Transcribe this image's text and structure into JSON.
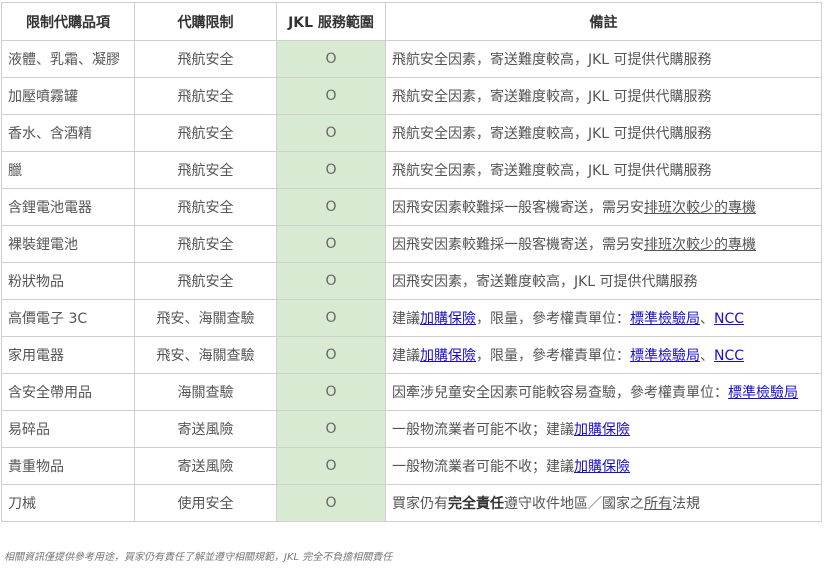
{
  "table": {
    "headers": [
      "限制代購品項",
      "代購限制",
      "JKL 服務範圍",
      "備註"
    ],
    "rows": [
      {
        "item": "液體、乳霜、凝膠",
        "limit": "飛航安全",
        "scope": "O",
        "note": "飛航安全因素，寄送難度較高，JKL 可提供代購服務"
      },
      {
        "item": "加壓噴霧罐",
        "limit": "飛航安全",
        "scope": "O",
        "note": "飛航安全因素，寄送難度較高，JKL 可提供代購服務"
      },
      {
        "item": "香水、含酒精",
        "limit": "飛航安全",
        "scope": "O",
        "note": "飛航安全因素，寄送難度較高，JKL 可提供代購服務"
      },
      {
        "item": "臘",
        "limit": "飛航安全",
        "scope": "O",
        "note": "飛航安全因素，寄送難度較高，JKL 可提供代購服務"
      },
      {
        "item": "含鋰電池電器",
        "limit": "飛航安全",
        "scope": "O",
        "note_a": "因飛安因素較難採一般客機寄送，需另安",
        "note_u": "排班次較少的專機"
      },
      {
        "item": "裸裝鋰電池",
        "limit": "飛航安全",
        "scope": "O",
        "note_a": "因飛安因素較難採一般客機寄送，需另安",
        "note_u": "排班次較少的專機"
      },
      {
        "item": "粉狀物品",
        "limit": "飛航安全",
        "scope": "O",
        "note": "因飛安因素，寄送難度較高，JKL 可提供代購服務"
      },
      {
        "item": "高價電子 3C",
        "limit": "飛安、海關查驗",
        "scope": "O",
        "note_a": "建議",
        "link1": "加購保險",
        "note_b": "，限量，參考權責單位：",
        "link2": "標準檢驗局",
        "sep": "、",
        "link3": "NCC"
      },
      {
        "item": "家用電器",
        "limit": "飛安、海關查驗",
        "scope": "O",
        "note_a": "建議",
        "link1": "加購保險",
        "note_b": "，限量，參考權責單位：",
        "link2": "標準檢驗局",
        "sep": "、",
        "link3": "NCC"
      },
      {
        "item": "含安全帶用品",
        "limit": "海關查驗",
        "scope": "O",
        "note_a": "因牽涉兒童安全因素可能較容易查驗，參考權責單位：",
        "link1": "標準檢驗局"
      },
      {
        "item": "易碎品",
        "limit": "寄送風險",
        "scope": "O",
        "note_a": "一般物流業者可能不收；建議",
        "link1": "加購保險"
      },
      {
        "item": "貴重物品",
        "limit": "寄送風險",
        "scope": "O",
        "note_a": "一般物流業者可能不收；建議",
        "link1": "加購保險"
      },
      {
        "item": "刀械",
        "limit": "使用安全",
        "scope": "O",
        "note_a": "買家仍有",
        "note_bold": "完全責任",
        "note_b": "遵守收件地區／國家之",
        "note_u": "所有",
        "note_c": "法規"
      }
    ]
  },
  "footer": "相關資訊僅提供參考用途，買家仍有責任了解並遵守相關規範，JKL 完全不負擔相關責任"
}
